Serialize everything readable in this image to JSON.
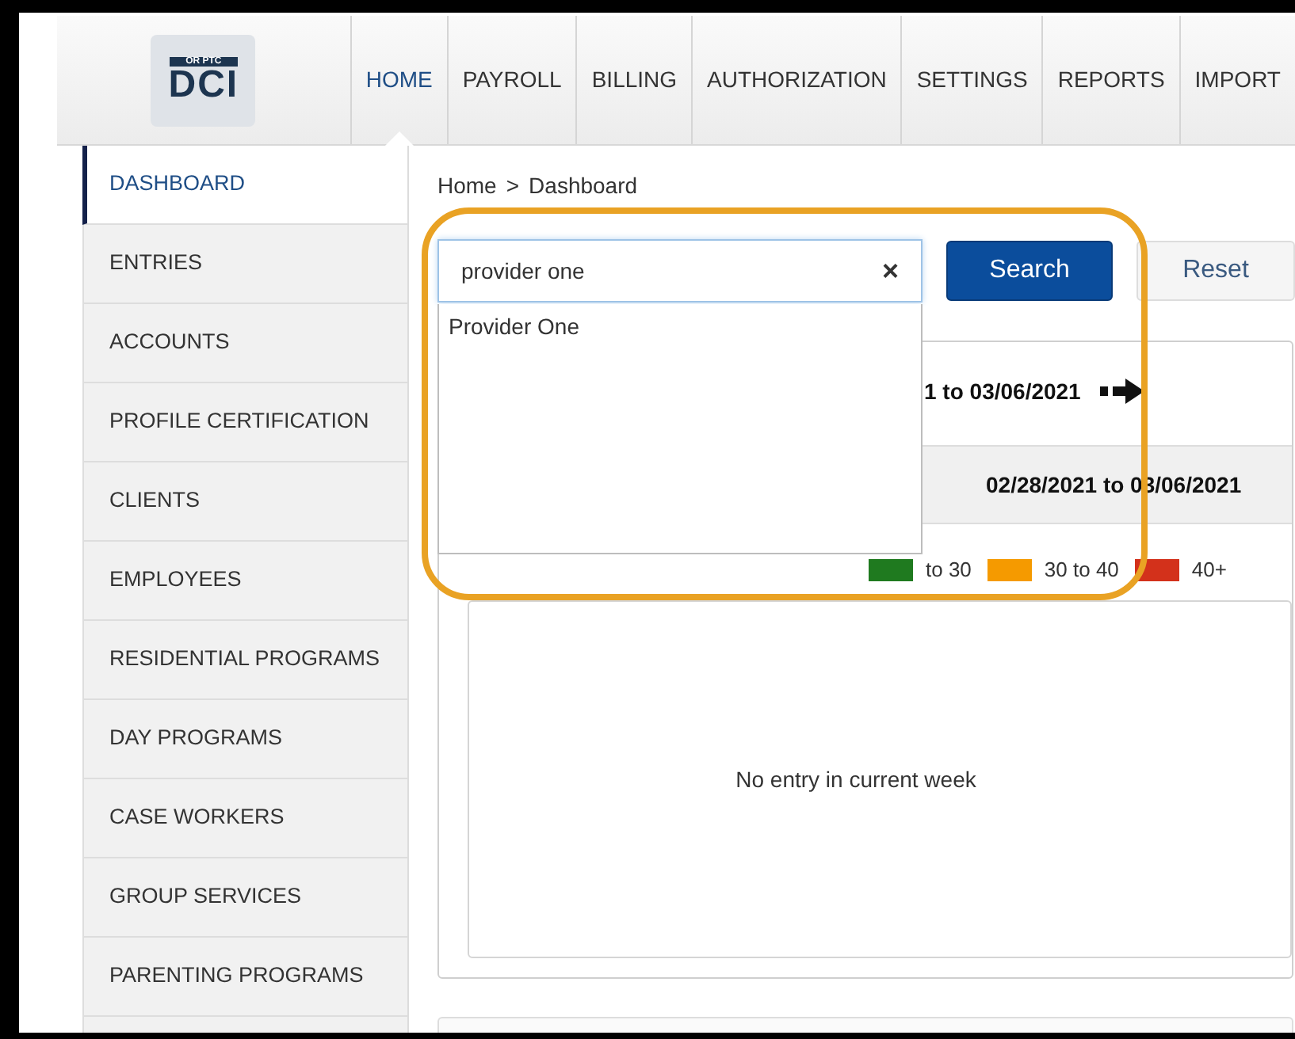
{
  "logo": {
    "top": "OR PTC",
    "main": "DCI"
  },
  "nav": [
    {
      "label": "HOME",
      "selected": true
    },
    {
      "label": "PAYROLL",
      "selected": false
    },
    {
      "label": "BILLING",
      "selected": false
    },
    {
      "label": "AUTHORIZATION",
      "selected": false
    },
    {
      "label": "SETTINGS",
      "selected": false
    },
    {
      "label": "REPORTS",
      "selected": false
    },
    {
      "label": "IMPORT",
      "selected": false
    }
  ],
  "sidebar": {
    "items": [
      {
        "label": "DASHBOARD",
        "selected": true
      },
      {
        "label": "ENTRIES",
        "selected": false
      },
      {
        "label": "ACCOUNTS",
        "selected": false
      },
      {
        "label": "PROFILE CERTIFICATION",
        "selected": false
      },
      {
        "label": "CLIENTS",
        "selected": false
      },
      {
        "label": "EMPLOYEES",
        "selected": false
      },
      {
        "label": "RESIDENTIAL PROGRAMS",
        "selected": false
      },
      {
        "label": "DAY PROGRAMS",
        "selected": false
      },
      {
        "label": "CASE WORKERS",
        "selected": false
      },
      {
        "label": "GROUP SERVICES",
        "selected": false
      },
      {
        "label": "PARENTING PROGRAMS",
        "selected": false
      }
    ]
  },
  "breadcrumb": {
    "items": [
      "Home",
      "Dashboard"
    ],
    "separator": ">"
  },
  "search": {
    "value": "provider one",
    "clear": "×",
    "suggestions": [
      "Provider One"
    ]
  },
  "buttons": [
    {
      "label": "Search",
      "kind": "primary"
    },
    {
      "label": "Reset",
      "kind": "secondary"
    }
  ],
  "week_nav": {
    "range": "1 to 03/06/2021"
  },
  "panel": {
    "range": "02/28/2021 to 03/06/2021",
    "legend": [
      {
        "label": "to 30",
        "color": "#1f7a1f"
      },
      {
        "label": "30 to 40",
        "color": "#f59a00"
      },
      {
        "label": "40+",
        "color": "#d3311b"
      }
    ],
    "empty_message": "No entry in current week"
  }
}
